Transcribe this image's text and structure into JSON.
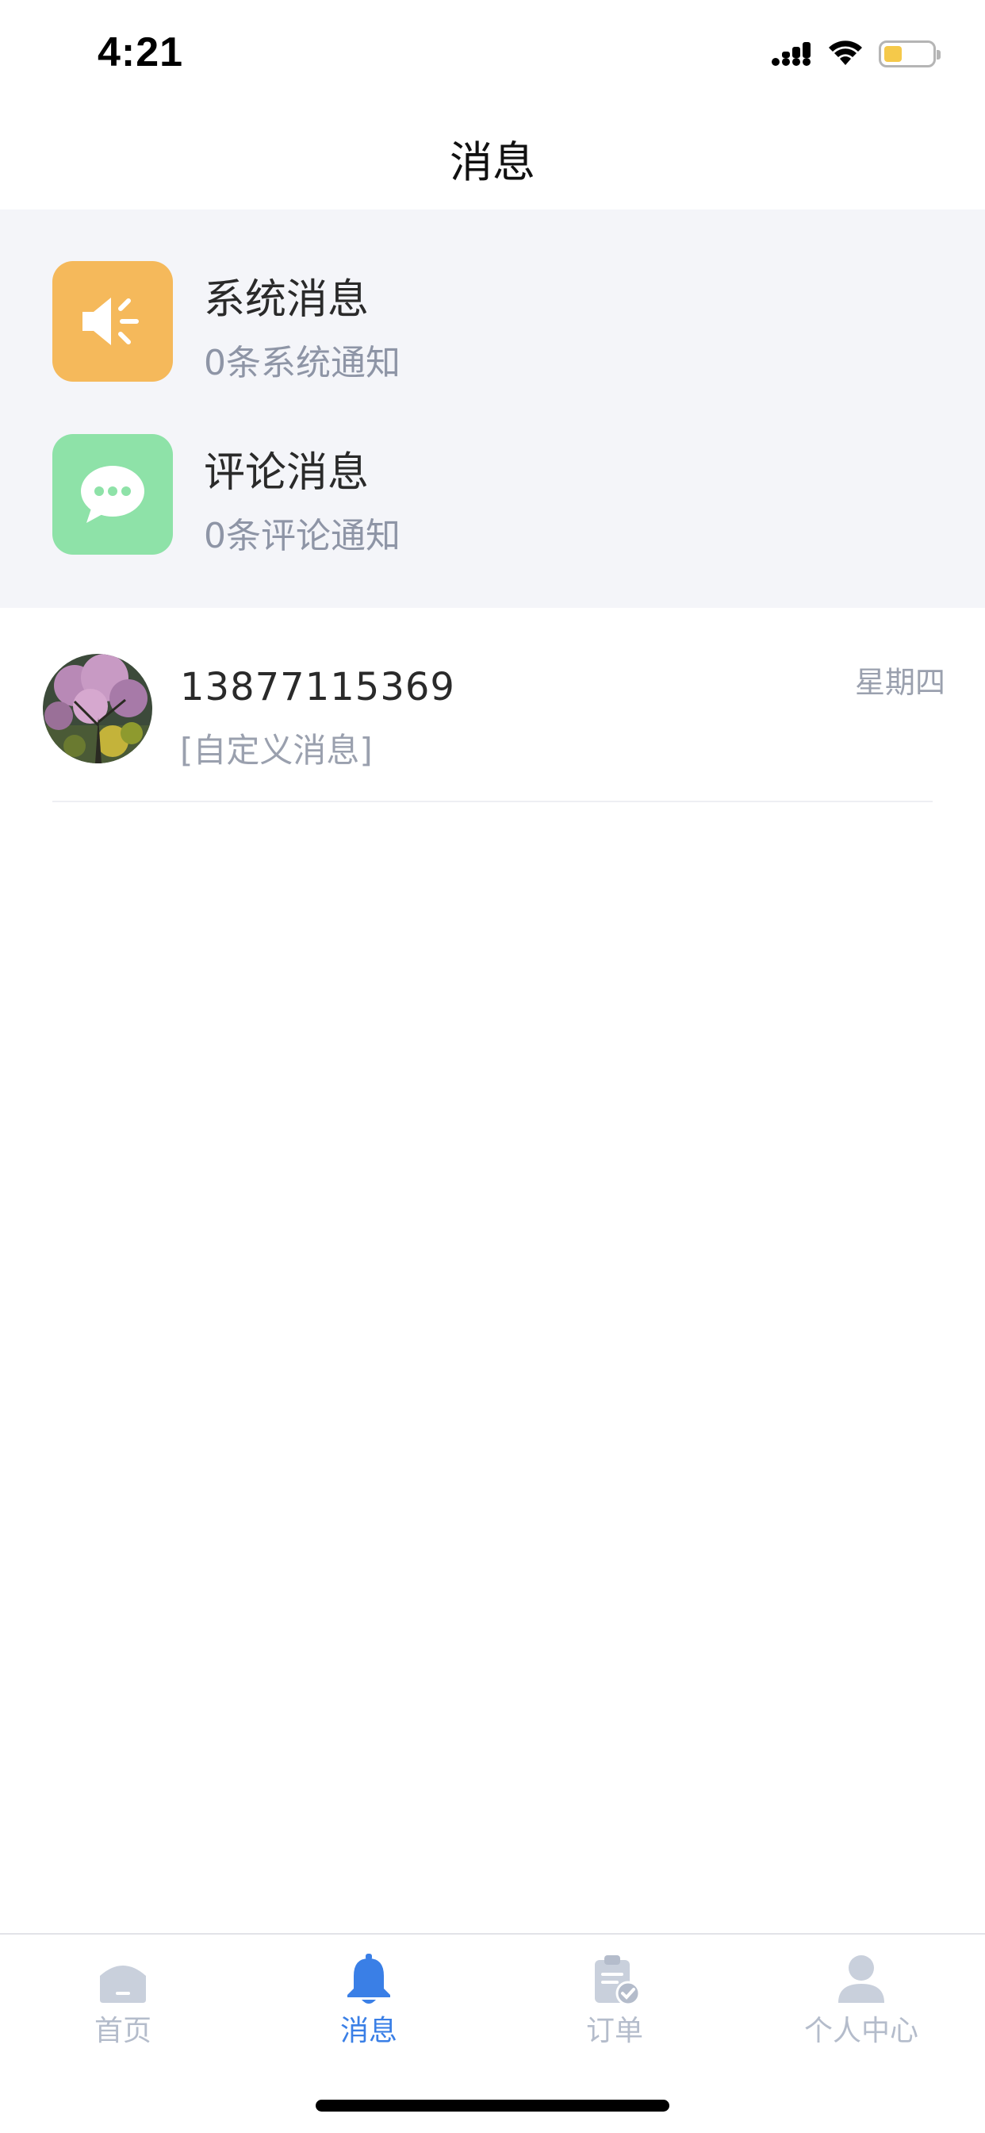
{
  "status_bar": {
    "time": "4:21",
    "battery_level": 0.45,
    "icons": [
      "signal-icon",
      "wifi-icon",
      "battery-icon"
    ]
  },
  "header": {
    "title": "消息"
  },
  "notices": [
    {
      "title": "系统消息",
      "subtitle": "0条系统通知",
      "icon": "megaphone-icon",
      "color": "#f5b95b"
    },
    {
      "title": "评论消息",
      "subtitle": "0条评论通知",
      "icon": "chat-bubble-icon",
      "color": "#8ee2a8"
    }
  ],
  "chats": [
    {
      "name": "13877115369",
      "preview": "[自定义消息]",
      "time": "星期四",
      "avatar": "avatar-photo"
    }
  ],
  "tabs": [
    {
      "label": "首页",
      "icon": "home-icon",
      "active": false
    },
    {
      "label": "消息",
      "icon": "bell-icon",
      "active": true
    },
    {
      "label": "订单",
      "icon": "clipboard-check-icon",
      "active": false
    },
    {
      "label": "个人中心",
      "icon": "person-icon",
      "active": false
    }
  ],
  "colors": {
    "accent": "#3a7fe6",
    "tab_inactive": "#b4bccb",
    "section_bg": "#f4f5f9",
    "muted_text": "#8e95a6"
  }
}
